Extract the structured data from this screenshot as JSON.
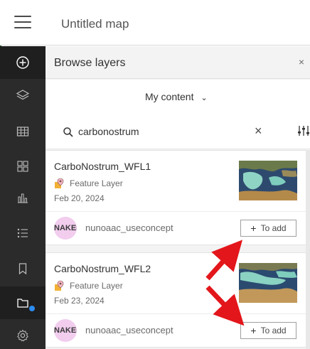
{
  "header": {
    "title": "Untitled map"
  },
  "panel": {
    "title": "Browse layers",
    "close": "×",
    "scope": "My content"
  },
  "search": {
    "value": "carbonostrum",
    "clear": "×"
  },
  "results": [
    {
      "title": "CarboNostrum_WFL1",
      "type": "Feature Layer",
      "date": "Feb 20, 2024",
      "avatar_text": "NAKEI",
      "owner": "nunoaac_useconcept",
      "add_label": "To add"
    },
    {
      "title": "CarboNostrum_WFL2",
      "type": "Feature Layer",
      "date": "Feb 23, 2024",
      "avatar_text": "NAKEI",
      "owner": "nunoaac_useconcept",
      "add_label": "To add"
    }
  ],
  "colors": {
    "toolbar": "#2b2b2b",
    "accent": "#2d8cf0",
    "arrow": "#e3161b",
    "avatar": "#f2cdee"
  },
  "icons": [
    "menu-icon",
    "add-icon",
    "layers-icon",
    "table-icon",
    "basemap-icon",
    "charts-icon",
    "legend-icon",
    "bookmark-icon",
    "browse-layers-icon",
    "settings-icon",
    "search-icon",
    "filter-icon",
    "feature-layer-icon"
  ]
}
